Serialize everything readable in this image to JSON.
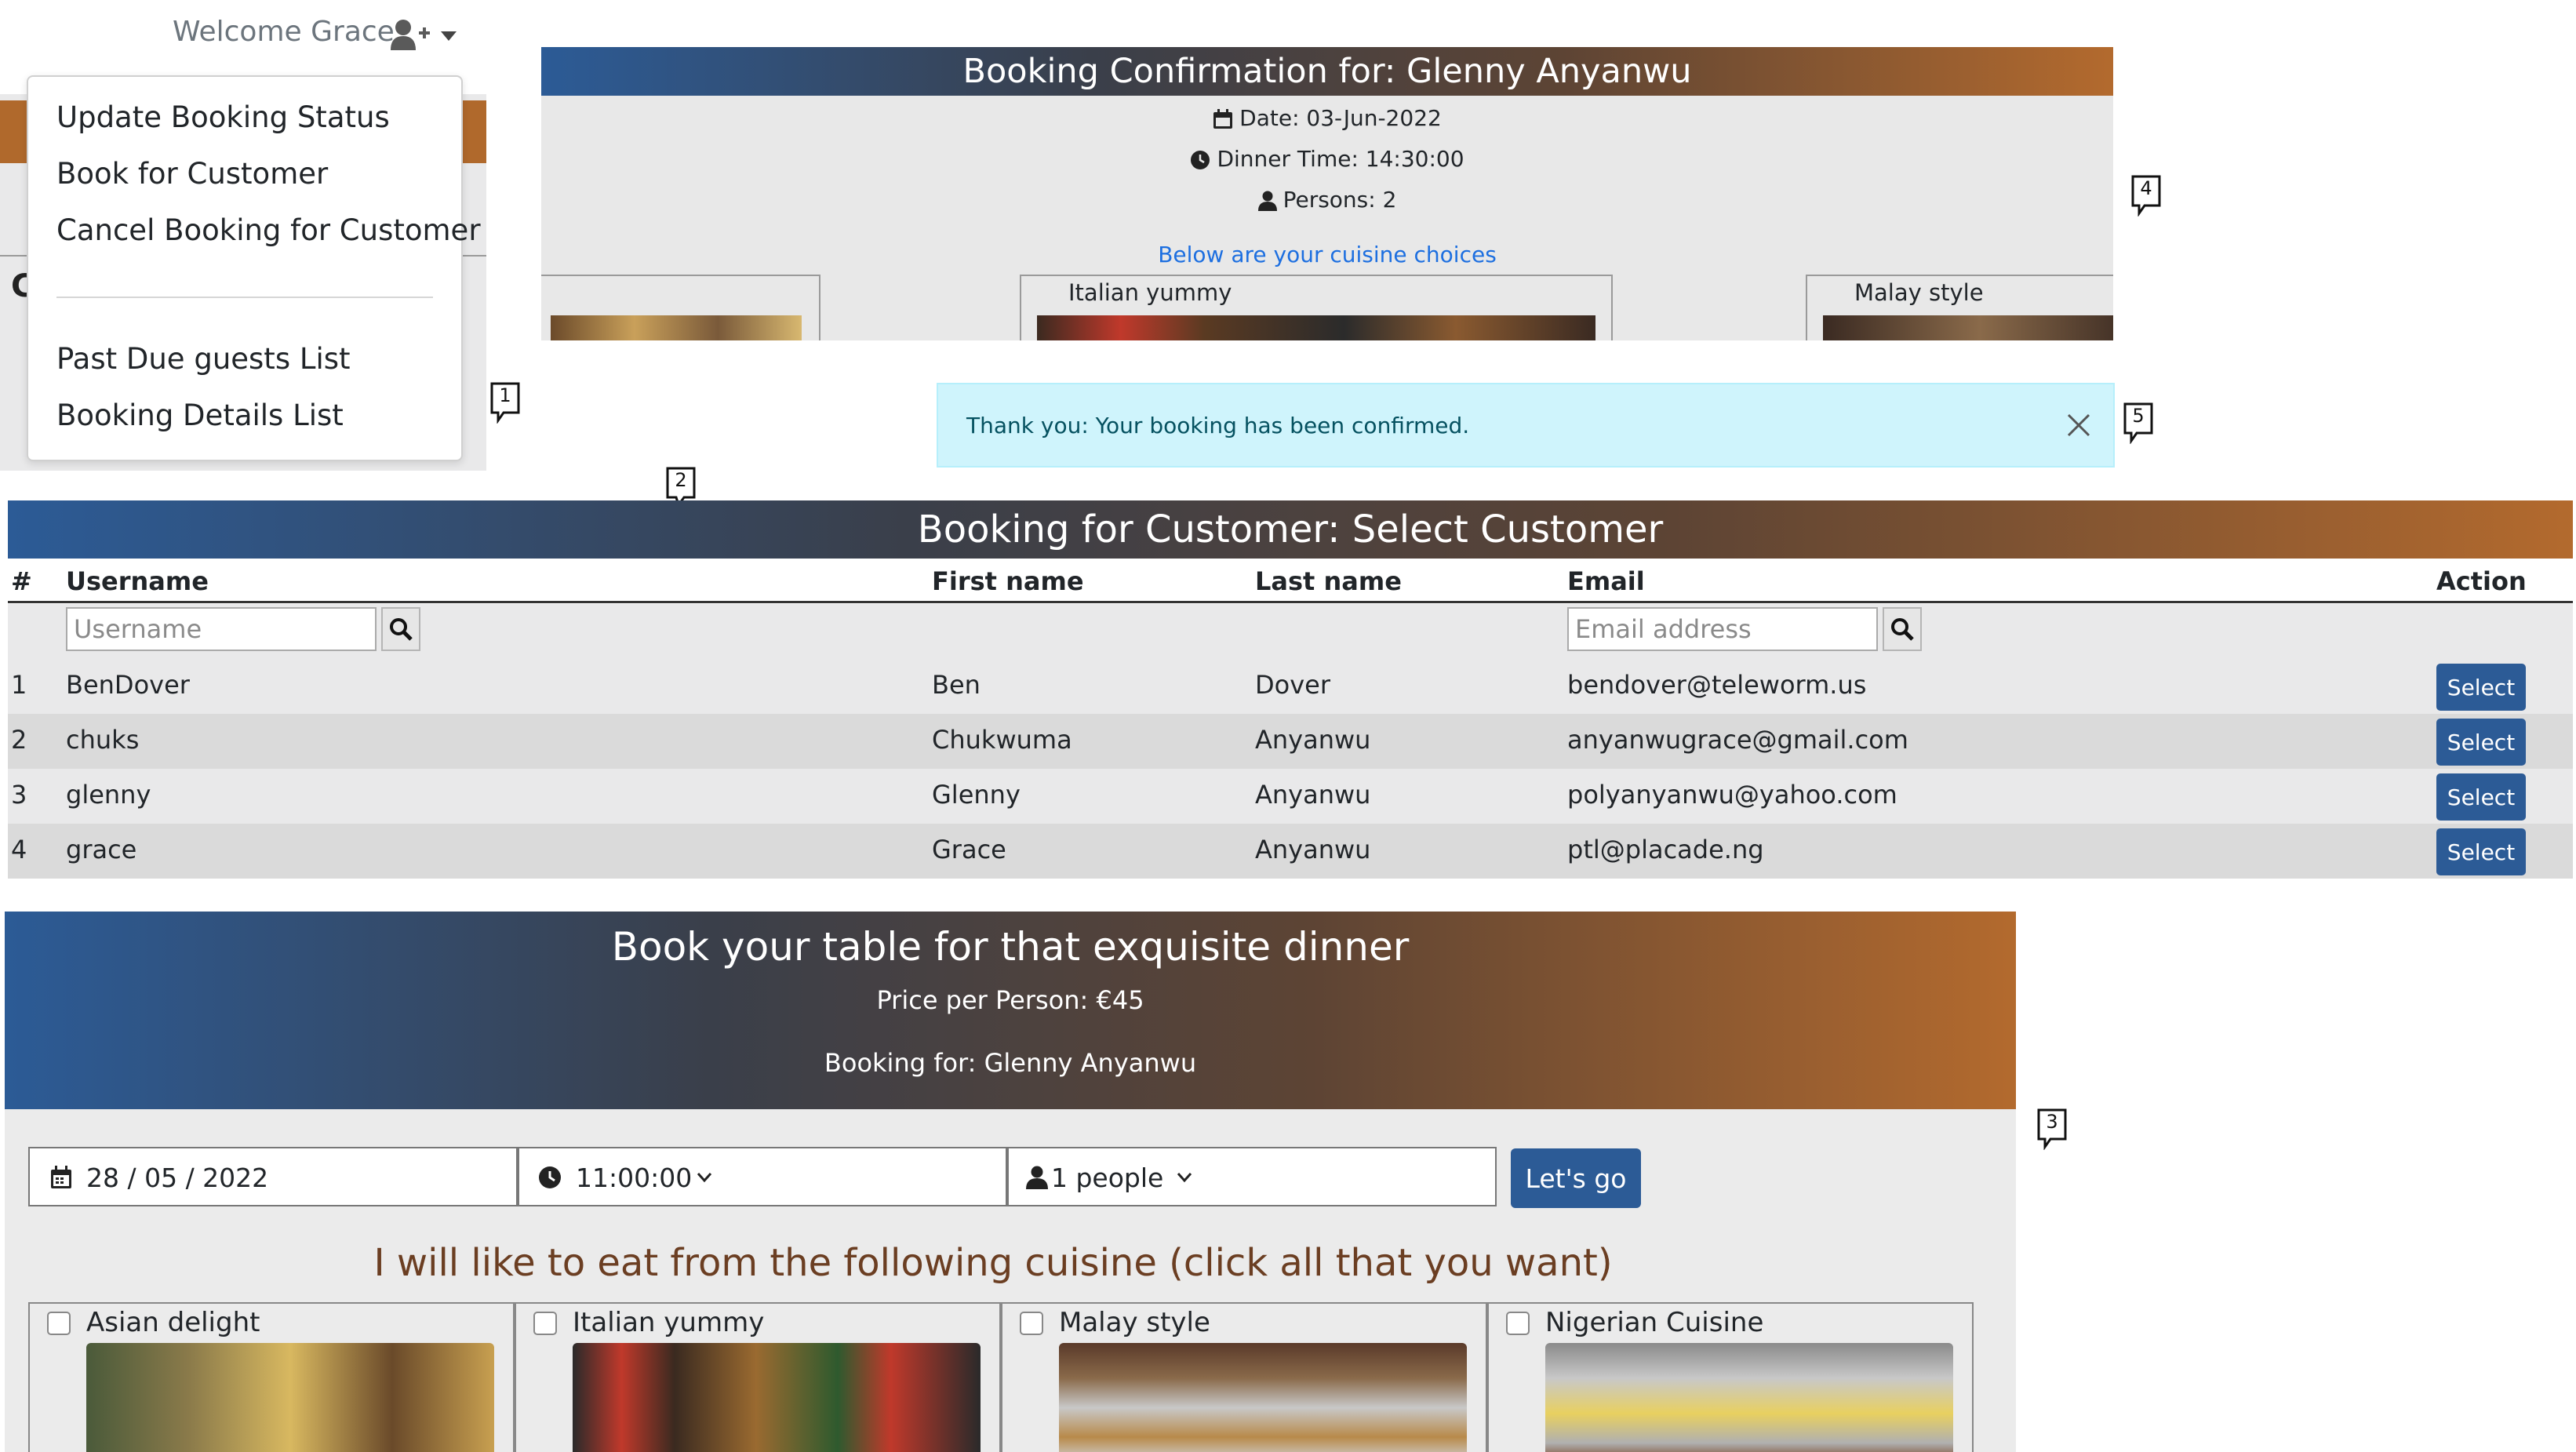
{
  "user_menu": {
    "welcome": "Welcome Grace",
    "items": [
      {
        "label": "Update Booking Status"
      },
      {
        "label": "Book for Customer"
      },
      {
        "label": "Cancel Booking for Customer"
      },
      {
        "label": "Past Due guests List"
      },
      {
        "label": "Booking Details List"
      }
    ],
    "partial_heading_char": "C"
  },
  "callouts": [
    "1",
    "2",
    "3",
    "4",
    "5"
  ],
  "confirmation": {
    "title": "Booking Confirmation for: Glenny Anyanwu",
    "date": "Date: 03-Jun-2022",
    "time": "Dinner Time: 14:30:00",
    "persons": "Persons: 2",
    "cuisine_note": "Below are your cuisine choices",
    "cards": [
      {
        "label": ""
      },
      {
        "label": "Italian yummy"
      },
      {
        "label": "Malay style"
      }
    ]
  },
  "alert": {
    "text": "Thank you: Your booking has been confirmed."
  },
  "customer_table": {
    "title": "Booking for Customer: Select Customer",
    "columns": [
      "#",
      "Username",
      "First name",
      "Last name",
      "Email",
      "Action"
    ],
    "username_placeholder": "Username",
    "email_placeholder": "Email address",
    "select_label": "Select",
    "rows": [
      {
        "num": "1",
        "username": "BenDover",
        "first": "Ben",
        "last": "Dover",
        "email": "bendover@teleworm.us"
      },
      {
        "num": "2",
        "username": "chuks",
        "first": "Chukwuma",
        "last": "Anyanwu",
        "email": "anyanwugrace@gmail.com"
      },
      {
        "num": "3",
        "username": "glenny",
        "first": "Glenny",
        "last": "Anyanwu",
        "email": "polyanyanwu@yahoo.com"
      },
      {
        "num": "4",
        "username": "grace",
        "first": "Grace",
        "last": "Anyanwu",
        "email": "ptl@placade.ng"
      }
    ]
  },
  "booking_form": {
    "title": "Book your table for that exquisite dinner",
    "price": "Price per Person: €45",
    "booking_for": "Booking for: Glenny Anyanwu",
    "date_value": "28 / 05 / 2022",
    "time_value": "11:00:00",
    "people_value": "1 people",
    "go_label": "Let's go",
    "cuisine_heading": "I will like to eat from the following cuisine (click all that you want)",
    "cuisines": [
      {
        "label": "Asian delight"
      },
      {
        "label": "Italian yummy"
      },
      {
        "label": "Malay style"
      },
      {
        "label": "Nigerian Cuisine"
      }
    ]
  },
  "colors": {
    "brand_blue": "#2c5b96",
    "brand_brown": "#b36a2e",
    "alert_bg": "#cff4fc",
    "heading_brown": "#6b3e22"
  },
  "icons": [
    "user-plus-icon",
    "caret-down-icon",
    "calendar-icon",
    "clock-icon",
    "person-icon",
    "search-icon",
    "close-icon",
    "chevron-down-icon",
    "speech-bubble-icon"
  ]
}
